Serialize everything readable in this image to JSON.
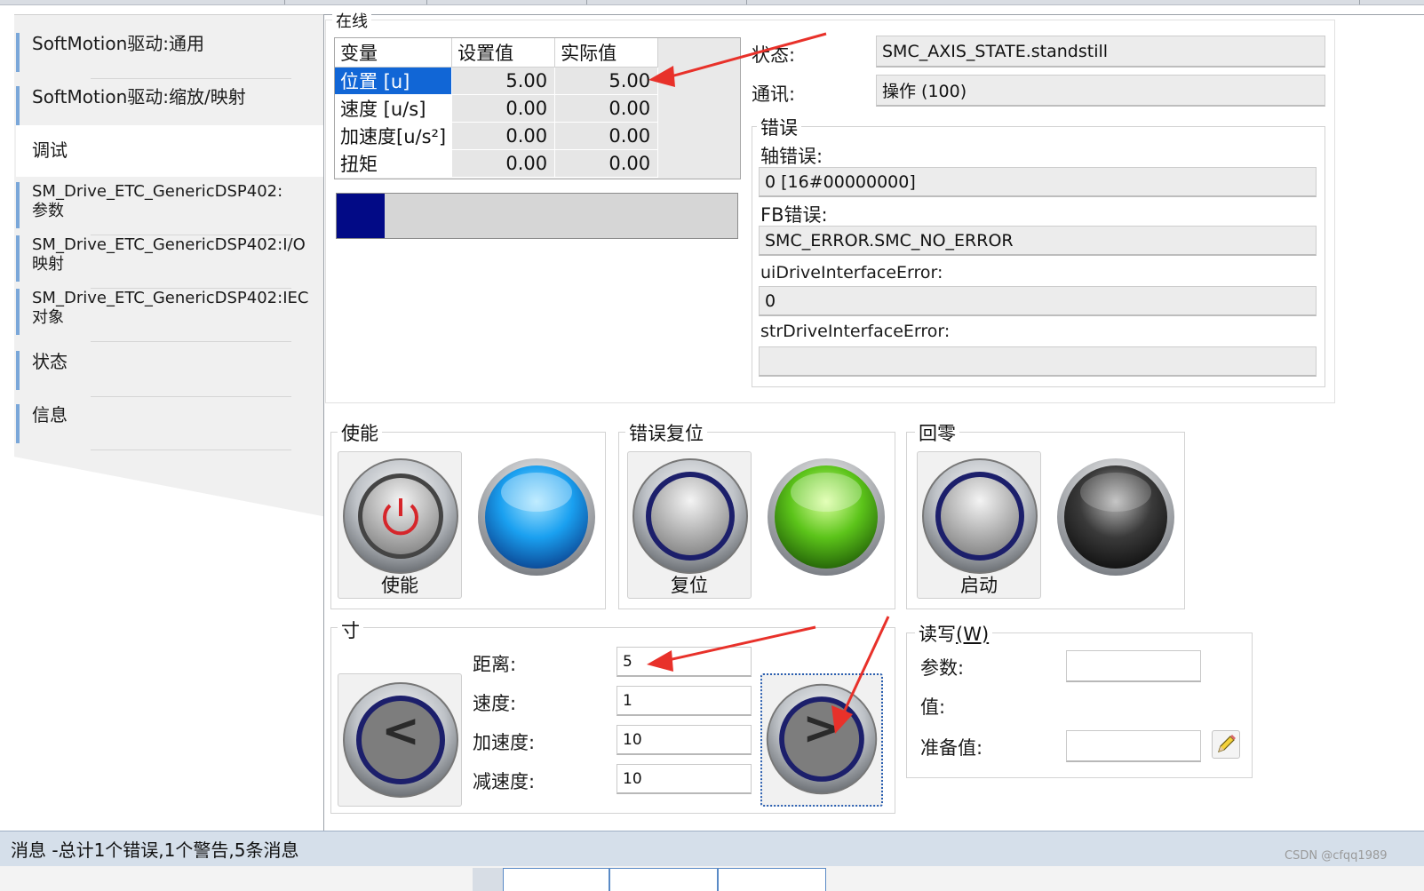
{
  "left_tabs": [
    {
      "label": "SoftMotion驱动:通用"
    },
    {
      "label": "SoftMotion驱动:缩放/映射"
    },
    {
      "label": "调试",
      "active": true
    },
    {
      "label": "SM_Drive_ETC_GenericDSP402:参数"
    },
    {
      "label": "SM_Drive_ETC_GenericDSP402:I/O映射"
    },
    {
      "label": "SM_Drive_ETC_GenericDSP402:IEC对象"
    },
    {
      "label": "状态"
    },
    {
      "label": "信息"
    }
  ],
  "online": {
    "group_title": "在线",
    "headers": [
      "变量",
      "设置值",
      "实际值"
    ],
    "rows": [
      {
        "name": "位置 [u]",
        "set": "5.00",
        "actual": "5.00",
        "selected": true
      },
      {
        "name": "速度 [u/s]",
        "set": "0.00",
        "actual": "0.00"
      },
      {
        "name": "加速度[u/s²]",
        "set": "0.00",
        "actual": "0.00"
      },
      {
        "name": "扭矩",
        "set": "0.00",
        "actual": "0.00"
      }
    ],
    "progress_fraction": 0.12,
    "progress_color": "#020a86"
  },
  "status": {
    "state_label": "状态:",
    "state_value": "SMC_AXIS_STATE.standstill",
    "comm_label": "通讯:",
    "comm_value": "操作 (100)",
    "error_group_title": "错误",
    "axis_error_label": "轴错误:",
    "axis_error_value": "0 [16#00000000]",
    "fb_error_label": "FB错误:",
    "fb_error_value": "SMC_ERROR.SMC_NO_ERROR",
    "ui_drive_label": "uiDriveInterfaceError:",
    "ui_drive_value": "0",
    "str_drive_label": "strDriveInterfaceError:",
    "str_drive_value": ""
  },
  "controls": {
    "enable": {
      "title": "使能",
      "button_label": "使能",
      "lamp": "blue",
      "lamp_color": "#1aa0f0"
    },
    "reset": {
      "title": "错误复位",
      "button_label": "复位",
      "lamp": "green",
      "lamp_color": "#5cc41a"
    },
    "home": {
      "title": "回零",
      "button_label": "启动",
      "lamp": "dark",
      "lamp_color": "#3a3a3a"
    }
  },
  "jog": {
    "title": "寸",
    "distance_label": "距离:",
    "distance_value": "5",
    "speed_label": "速度:",
    "speed_value": "1",
    "accel_label": "加速度:",
    "accel_value": "10",
    "decel_label": "减速度:",
    "decel_value": "10",
    "left_glyph": "<",
    "right_glyph": ">"
  },
  "readwrite": {
    "title": "读写",
    "title_hotkey": "(W)",
    "param_label": "参数:",
    "param_value": "",
    "value_label": "值:",
    "prepare_label": "准备值:",
    "prepare_value": "",
    "edit_icon": "pencil-icon"
  },
  "statusbar": {
    "message": "消息 -总计1个错误,1个警告,5条消息"
  },
  "watermark": "CSDN @cfqq1989",
  "annotation_color": "#e8312a"
}
